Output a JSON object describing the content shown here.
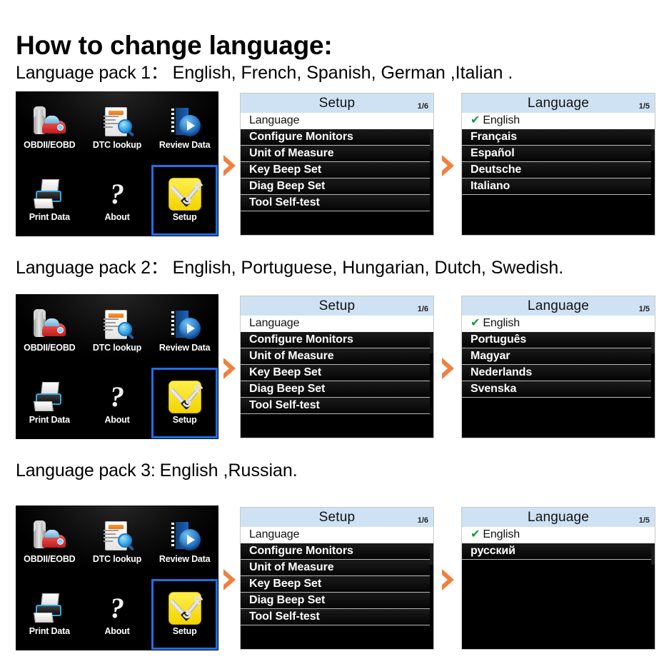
{
  "title": "How to change language:",
  "packs": [
    {
      "label": "Language pack 1：",
      "languages": "English, French, Spanish, German ,Italian .",
      "home": {
        "items": [
          {
            "label": "OBDII/EOBD",
            "icon": "wrench-car-icon",
            "selected": false
          },
          {
            "label": "DTC lookup",
            "icon": "document-magnifier-icon",
            "selected": false
          },
          {
            "label": "Review Data",
            "icon": "film-play-icon",
            "selected": false
          },
          {
            "label": "Print Data",
            "icon": "printer-icon",
            "selected": false
          },
          {
            "label": "About",
            "icon": "question-mark-icon",
            "selected": false
          },
          {
            "label": "Setup",
            "icon": "wrench-screwdriver-icon",
            "selected": true
          }
        ]
      },
      "setup": {
        "title": "Setup",
        "page": "1/6",
        "items": [
          {
            "label": "Language",
            "selected": true
          },
          {
            "label": "Configure Monitors",
            "selected": false
          },
          {
            "label": "Unit of Measure",
            "selected": false
          },
          {
            "label": "Key Beep Set",
            "selected": false
          },
          {
            "label": "Diag Beep Set",
            "selected": false
          },
          {
            "label": "Tool Self-test",
            "selected": false
          }
        ]
      },
      "language": {
        "title": "Language",
        "page": "1/5",
        "items": [
          {
            "label": "English",
            "checked": true,
            "selected": true
          },
          {
            "label": "Français",
            "checked": false,
            "selected": false
          },
          {
            "label": "Español",
            "checked": false,
            "selected": false
          },
          {
            "label": "Deutsche",
            "checked": false,
            "selected": false
          },
          {
            "label": "Italiano",
            "checked": false,
            "selected": false
          }
        ]
      }
    },
    {
      "label": "Language pack 2：",
      "languages": "English, Portuguese, Hungarian, Dutch, Swedish.",
      "home": {
        "items": [
          {
            "label": "OBDII/EOBD",
            "icon": "wrench-car-icon",
            "selected": false
          },
          {
            "label": "DTC lookup",
            "icon": "document-magnifier-icon",
            "selected": false
          },
          {
            "label": "Review Data",
            "icon": "film-play-icon",
            "selected": false
          },
          {
            "label": "Print Data",
            "icon": "printer-icon",
            "selected": false
          },
          {
            "label": "About",
            "icon": "question-mark-icon",
            "selected": false
          },
          {
            "label": "Setup",
            "icon": "wrench-screwdriver-icon",
            "selected": true
          }
        ]
      },
      "setup": {
        "title": "Setup",
        "page": "1/6",
        "items": [
          {
            "label": "Language",
            "selected": true
          },
          {
            "label": "Configure Monitors",
            "selected": false
          },
          {
            "label": "Unit of Measure",
            "selected": false
          },
          {
            "label": "Key Beep Set",
            "selected": false
          },
          {
            "label": "Diag Beep Set",
            "selected": false
          },
          {
            "label": "Tool Self-test",
            "selected": false
          }
        ]
      },
      "language": {
        "title": "Language",
        "page": "1/5",
        "items": [
          {
            "label": "English",
            "checked": true,
            "selected": true
          },
          {
            "label": "Português",
            "checked": false,
            "selected": false
          },
          {
            "label": "Magyar",
            "checked": false,
            "selected": false
          },
          {
            "label": "Nederlands",
            "checked": false,
            "selected": false
          },
          {
            "label": "Svenska",
            "checked": false,
            "selected": false
          }
        ]
      }
    },
    {
      "label": "Language pack 3:",
      "languages": "English ,Russian.",
      "home": {
        "items": [
          {
            "label": "OBDII/EOBD",
            "icon": "wrench-car-icon",
            "selected": false
          },
          {
            "label": "DTC lookup",
            "icon": "document-magnifier-icon",
            "selected": false
          },
          {
            "label": "Review Data",
            "icon": "film-play-icon",
            "selected": false
          },
          {
            "label": "Print Data",
            "icon": "printer-icon",
            "selected": false
          },
          {
            "label": "About",
            "icon": "question-mark-icon",
            "selected": false
          },
          {
            "label": "Setup",
            "icon": "wrench-screwdriver-icon",
            "selected": true
          }
        ]
      },
      "setup": {
        "title": "Setup",
        "page": "1/6",
        "items": [
          {
            "label": "Language",
            "selected": true
          },
          {
            "label": "Configure Monitors",
            "selected": false
          },
          {
            "label": "Unit of Measure",
            "selected": false
          },
          {
            "label": "Key Beep Set",
            "selected": false
          },
          {
            "label": "Diag Beep Set",
            "selected": false
          },
          {
            "label": "Tool Self-test",
            "selected": false
          }
        ]
      },
      "language": {
        "title": "Language",
        "page": "1/5",
        "items": [
          {
            "label": "English",
            "checked": true,
            "selected": true
          },
          {
            "label": "русский",
            "checked": false,
            "selected": false
          }
        ]
      }
    }
  ],
  "icons": {
    "arrow": "chevron-right-icon",
    "check": "✔"
  },
  "colors": {
    "arrow": "#ef8040",
    "titlebar": "#cfe2f3",
    "selection": "#1f6fe6",
    "check": "#14a33c",
    "setup_tile": "#f2d400"
  }
}
